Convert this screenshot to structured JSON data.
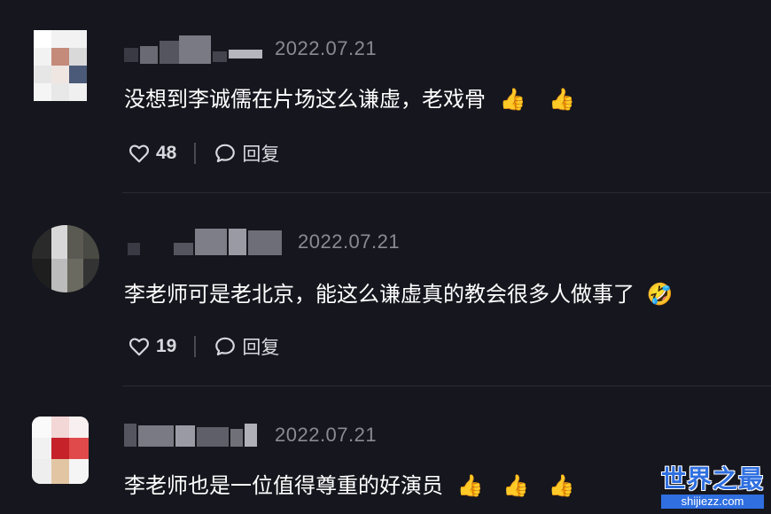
{
  "comments": [
    {
      "date": "2022.07.21",
      "text": "没想到李诚儒在片场这么谦虚，老戏骨",
      "emojis": [
        "👍",
        "👍"
      ],
      "likes": "48",
      "reply_label": "回复"
    },
    {
      "date": "2022.07.21",
      "text": "李老师可是老北京，能这么谦虚真的教会很多人做事了",
      "emojis": [
        "🤣"
      ],
      "likes": "19",
      "reply_label": "回复"
    },
    {
      "date": "2022.07.21",
      "text": "李老师也是一位值得尊重的好演员",
      "emojis": [
        "👍",
        "👍",
        "👍"
      ]
    }
  ],
  "watermark": {
    "title": "世界之最",
    "url": "shijiezz.com"
  },
  "icons": {
    "like": "heart-outline-icon",
    "reply": "speech-bubble-icon"
  },
  "colors": {
    "background": "#16161e",
    "text": "#ffffff",
    "meta": "#8a8a95",
    "watermark": "#2f6fe0"
  }
}
